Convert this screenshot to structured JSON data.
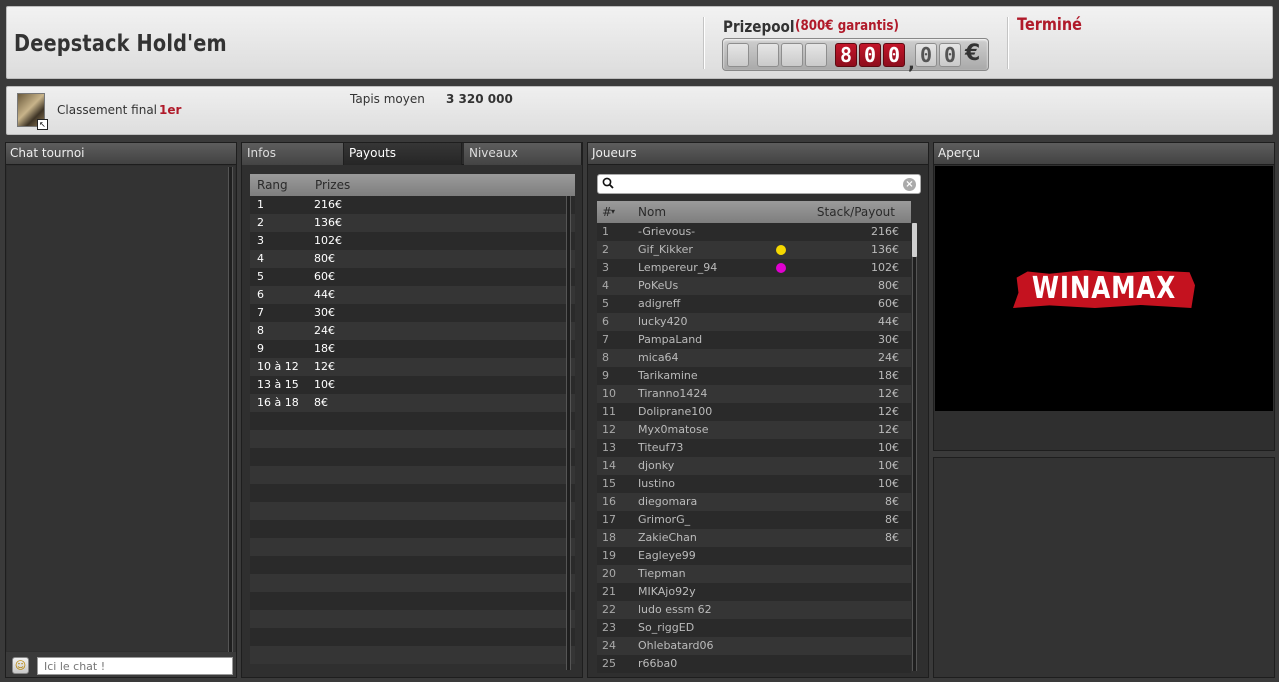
{
  "header": {
    "title": "Deepstack Hold'em",
    "prizepool_label": "Prizepool",
    "prizepool_guarantee": "(800€ garantis)",
    "prizepool_digits": [
      "8",
      "0",
      "0"
    ],
    "prizepool_decimals": [
      "0",
      "0"
    ],
    "currency": "€",
    "status": "Terminé"
  },
  "infobar": {
    "rank_label": "Classement final",
    "rank_value": "1er",
    "avg_stack_label": "Tapis moyen",
    "avg_stack_value": "3 320 000"
  },
  "chat": {
    "title": "Chat tournoi",
    "placeholder": "Ici le chat !",
    "smiley_icon": "smiley-icon"
  },
  "payouts": {
    "tabs": [
      "Infos",
      "Payouts",
      "Niveaux"
    ],
    "active_tab": "Payouts",
    "columns": [
      "Rang",
      "Prizes"
    ],
    "rows": [
      {
        "rank": "1",
        "prize": "216€"
      },
      {
        "rank": "2",
        "prize": "136€"
      },
      {
        "rank": "3",
        "prize": "102€"
      },
      {
        "rank": "4",
        "prize": "80€"
      },
      {
        "rank": "5",
        "prize": "60€"
      },
      {
        "rank": "6",
        "prize": "44€"
      },
      {
        "rank": "7",
        "prize": "30€"
      },
      {
        "rank": "8",
        "prize": "24€"
      },
      {
        "rank": "9",
        "prize": "18€"
      },
      {
        "rank": "10 à 12",
        "prize": "12€"
      },
      {
        "rank": "13 à 15",
        "prize": "10€"
      },
      {
        "rank": "16 à 18",
        "prize": "8€"
      }
    ]
  },
  "players": {
    "title": "Joueurs",
    "columns": [
      "#",
      "Nom",
      "Stack/Payout"
    ],
    "sort_icon": "sort-desc-icon",
    "colors": {
      "yellow": "#f5d800",
      "magenta": "#e000d0"
    },
    "rows": [
      {
        "n": "1",
        "name": "-Grievous-",
        "stack": "216€",
        "dot": ""
      },
      {
        "n": "2",
        "name": "Gif_Kikker",
        "stack": "136€",
        "dot": "#f5d800"
      },
      {
        "n": "3",
        "name": "Lempereur_94",
        "stack": "102€",
        "dot": "#e000d0"
      },
      {
        "n": "4",
        "name": "PoKeUs",
        "stack": "80€",
        "dot": ""
      },
      {
        "n": "5",
        "name": "adigreff",
        "stack": "60€",
        "dot": ""
      },
      {
        "n": "6",
        "name": "lucky420",
        "stack": "44€",
        "dot": ""
      },
      {
        "n": "7",
        "name": "PampaLand",
        "stack": "30€",
        "dot": ""
      },
      {
        "n": "8",
        "name": "mica64",
        "stack": "24€",
        "dot": ""
      },
      {
        "n": "9",
        "name": "Tarikamine",
        "stack": "18€",
        "dot": ""
      },
      {
        "n": "10",
        "name": "Tiranno1424",
        "stack": "12€",
        "dot": ""
      },
      {
        "n": "11",
        "name": "Doliprane100",
        "stack": "12€",
        "dot": ""
      },
      {
        "n": "12",
        "name": "Myx0matose",
        "stack": "12€",
        "dot": ""
      },
      {
        "n": "13",
        "name": "Titeuf73",
        "stack": "10€",
        "dot": ""
      },
      {
        "n": "14",
        "name": "djonky",
        "stack": "10€",
        "dot": ""
      },
      {
        "n": "15",
        "name": "Iustino",
        "stack": "10€",
        "dot": ""
      },
      {
        "n": "16",
        "name": "diegomara",
        "stack": "8€",
        "dot": ""
      },
      {
        "n": "17",
        "name": "GrimorG_",
        "stack": "8€",
        "dot": ""
      },
      {
        "n": "18",
        "name": "ZakieChan",
        "stack": "8€",
        "dot": ""
      },
      {
        "n": "19",
        "name": "Eagleye99",
        "stack": "",
        "dot": ""
      },
      {
        "n": "20",
        "name": "Tiepman",
        "stack": "",
        "dot": ""
      },
      {
        "n": "21",
        "name": "MIKAjo92y",
        "stack": "",
        "dot": ""
      },
      {
        "n": "22",
        "name": "ludo essm 62",
        "stack": "",
        "dot": ""
      },
      {
        "n": "23",
        "name": "So_riggED",
        "stack": "",
        "dot": ""
      },
      {
        "n": "24",
        "name": "Ohlebatard06",
        "stack": "",
        "dot": ""
      },
      {
        "n": "25",
        "name": "r66ba0",
        "stack": "",
        "dot": ""
      }
    ]
  },
  "preview": {
    "title": "Aperçu",
    "logo_text": "WINAMAX"
  }
}
